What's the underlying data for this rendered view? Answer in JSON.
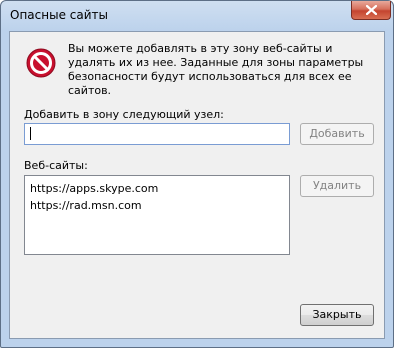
{
  "window": {
    "title": "Опасные сайты"
  },
  "info": {
    "text": "Вы можете добавлять в эту зону  веб-сайты и удалять их из нее. Заданные для зоны параметры безопасности будут использоваться для всех ее сайтов."
  },
  "add": {
    "label": "Добавить в зону следующий узел:",
    "value": "",
    "button": "Добавить"
  },
  "sites": {
    "label": "Веб-сайты:",
    "items": [
      "https://apps.skype.com",
      "https://rad.msn.com"
    ],
    "remove_button": "Удалить"
  },
  "footer": {
    "close_button": "Закрыть"
  },
  "icons": {
    "warning": "no-entry-icon",
    "close": "close-icon"
  },
  "colors": {
    "warning_red": "#c8102e",
    "close_button_red": "#c4442f"
  }
}
